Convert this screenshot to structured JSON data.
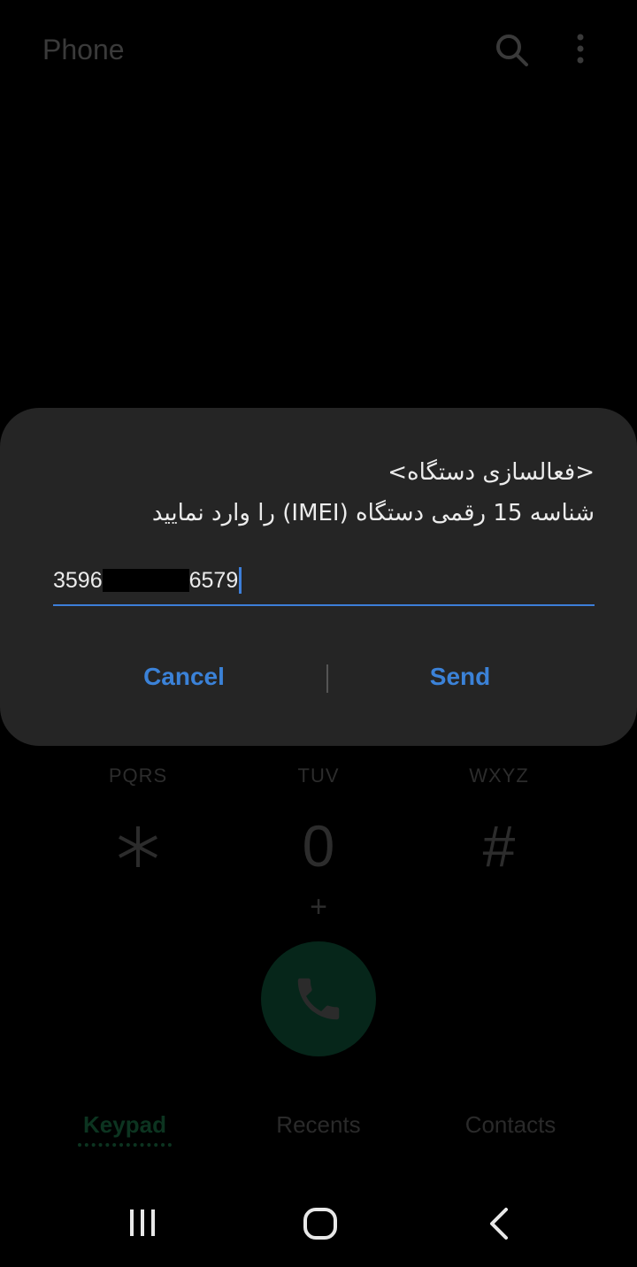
{
  "appbar": {
    "title": "Phone",
    "search_icon": "search-icon",
    "more_icon": "more-vert-icon"
  },
  "keypad": {
    "keys": [
      {
        "letters": "PQRS",
        "label": "*"
      },
      {
        "letters": "TUV",
        "label": "0"
      },
      {
        "letters": "WXYZ",
        "label": "#"
      }
    ],
    "plus": "+",
    "call_icon": "phone-icon"
  },
  "tabs": [
    {
      "label": "Keypad",
      "active": true
    },
    {
      "label": "Recents",
      "active": false
    },
    {
      "label": "Contacts",
      "active": false
    }
  ],
  "navbar": {
    "recent_icon": "recent-apps-icon",
    "home_icon": "home-icon",
    "back_icon": "back-icon"
  },
  "dialog": {
    "title_line": "<فعالسازی دستگاه>",
    "message_line": "شناسه 15 رقمی دستگاه (IMEI) را وارد نمایید",
    "input_prefix": "3596",
    "input_suffix": "6579",
    "cancel_label": "Cancel",
    "send_label": "Send"
  },
  "colors": {
    "accent": "#3b82d8",
    "dialog_bg": "#252525",
    "call_button": "#06261a"
  }
}
